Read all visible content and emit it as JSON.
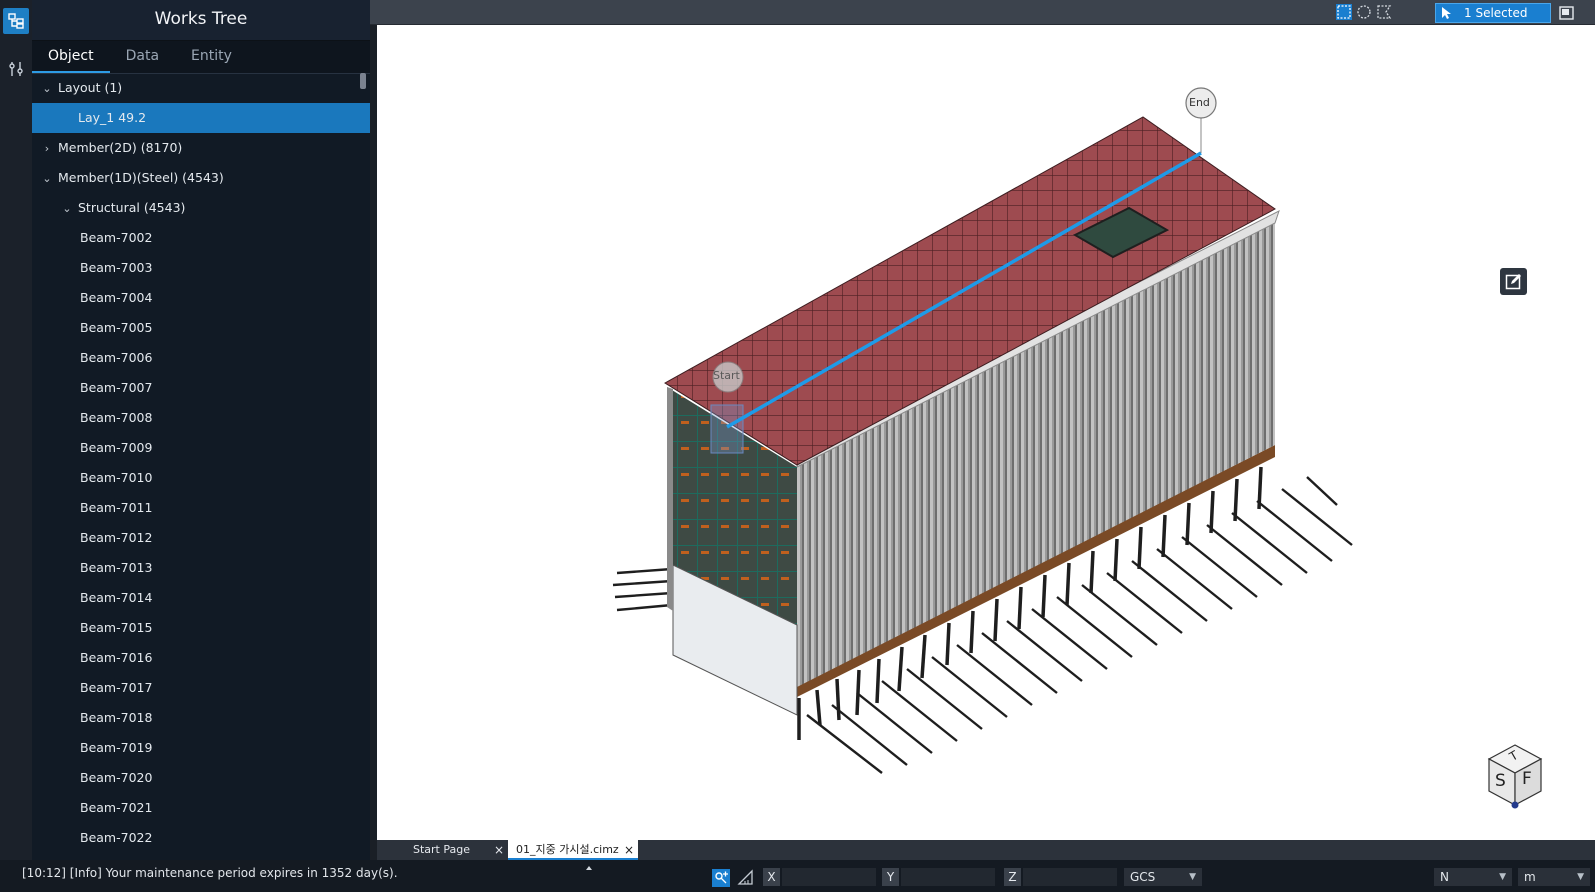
{
  "panel": {
    "title": "Works Tree",
    "tabs": [
      {
        "label": "Object",
        "active": true
      },
      {
        "label": "Data",
        "active": false
      },
      {
        "label": "Entity",
        "active": false
      }
    ]
  },
  "tree": [
    {
      "label": "Layout (1)",
      "expanded": true,
      "level": 0
    },
    {
      "label": "Lay_1 49.2",
      "level": 1,
      "selected": true
    },
    {
      "label": "Member(2D) (8170)",
      "expanded": false,
      "level": 0
    },
    {
      "label": "Member(1D)(Steel) (4543)",
      "expanded": true,
      "level": 0
    },
    {
      "label": "Structural (4543)",
      "expanded": true,
      "level": 1
    },
    {
      "label": "Beam-7002",
      "level": 2
    },
    {
      "label": "Beam-7003",
      "level": 2
    },
    {
      "label": "Beam-7004",
      "level": 2
    },
    {
      "label": "Beam-7005",
      "level": 2
    },
    {
      "label": "Beam-7006",
      "level": 2
    },
    {
      "label": "Beam-7007",
      "level": 2
    },
    {
      "label": "Beam-7008",
      "level": 2
    },
    {
      "label": "Beam-7009",
      "level": 2
    },
    {
      "label": "Beam-7010",
      "level": 2
    },
    {
      "label": "Beam-7011",
      "level": 2
    },
    {
      "label": "Beam-7012",
      "level": 2
    },
    {
      "label": "Beam-7013",
      "level": 2
    },
    {
      "label": "Beam-7014",
      "level": 2
    },
    {
      "label": "Beam-7015",
      "level": 2
    },
    {
      "label": "Beam-7016",
      "level": 2
    },
    {
      "label": "Beam-7017",
      "level": 2
    },
    {
      "label": "Beam-7018",
      "level": 2
    },
    {
      "label": "Beam-7019",
      "level": 2
    },
    {
      "label": "Beam-7020",
      "level": 2
    },
    {
      "label": "Beam-7021",
      "level": 2
    },
    {
      "label": "Beam-7022",
      "level": 2
    }
  ],
  "viewport": {
    "selection_label": "1 Selected",
    "start_marker": "Start",
    "end_marker": "End",
    "viewcube": {
      "top": "T",
      "left": "S",
      "right": "F"
    }
  },
  "doc_tabs": [
    {
      "label": "Start Page",
      "close": "×"
    },
    {
      "label": "01_지중 가시설.cimz",
      "close": "×",
      "active": true
    }
  ],
  "status": {
    "message": "[10:12] [Info] Your maintenance period expires in 1352 day(s).",
    "x_label": "X",
    "y_label": "Y",
    "z_label": "Z",
    "coord_system": "GCS",
    "direction": "N",
    "unit": "m"
  },
  "colors": {
    "accent": "#1a7fd0",
    "panel_bg": "#111a25",
    "roof": "#9a4a4e",
    "wall": "#8c8c8c",
    "path_line": "#1e9be8"
  }
}
